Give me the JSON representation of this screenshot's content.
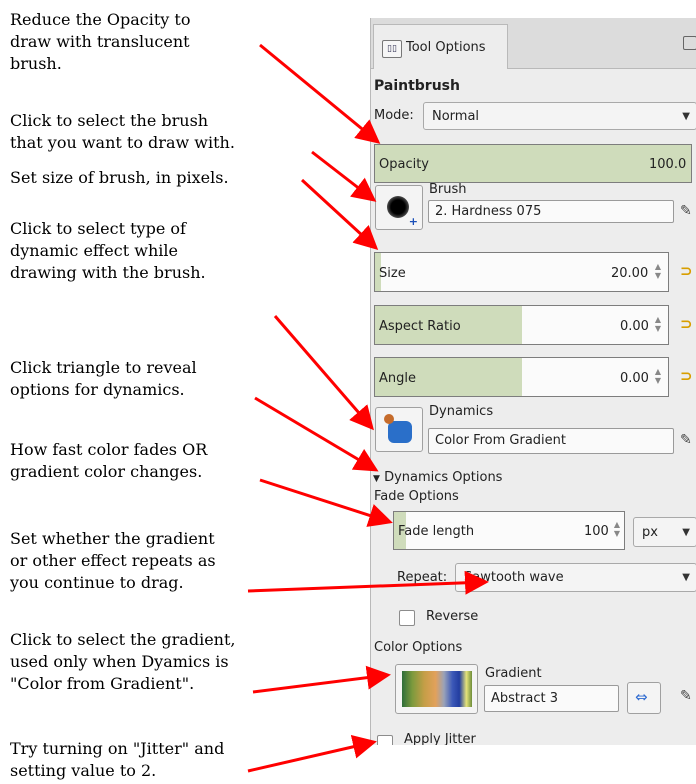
{
  "annotations": [
    "Reduce the Opacity to\ndraw with translucent\nbrush.",
    "Click to select the brush\nthat you want to draw with.",
    "Set size of brush, in pixels.",
    "Click to select type of\ndynamic effect while\ndrawing with the brush.",
    "Click triangle to reveal\noptions for dynamics.",
    "How fast color fades OR\ngradient color changes.",
    "Set whether the gradient\nor other effect repeats as\nyou continue to drag.",
    "Click to select the gradient,\nused only when Dyamics is\n\"Color from Gradient\".",
    "Try turning on \"Jitter\" and\nsetting value to 2."
  ],
  "panel": {
    "tab_label": "Tool Options",
    "tab_icon": "tool-options-icon",
    "tool_title": "Paintbrush",
    "mode_label": "Mode:",
    "mode_value": "Normal",
    "opacity": {
      "label": "Opacity",
      "value": "100.0",
      "level": 1.0
    },
    "brush_label": "Brush",
    "brush_name": "2. Hardness 075",
    "size": {
      "label": "Size",
      "value": "20.00",
      "level": 0.02
    },
    "aspect_ratio": {
      "label": "Aspect Ratio",
      "value": "0.00",
      "level": 0.5
    },
    "angle": {
      "label": "Angle",
      "value": "0.00",
      "level": 0.5
    },
    "dynamics_label": "Dynamics",
    "dynamics_name": "Color From Gradient",
    "dynamics_options_label": "Dynamics Options",
    "fade_options_label": "Fade Options",
    "fade_length": {
      "label": "Fade length",
      "value": "100",
      "unit": "px",
      "level": 0.05
    },
    "repeat_label": "Repeat:",
    "repeat_value": "Sawtooth wave",
    "reverse_label": "Reverse",
    "color_options_label": "Color Options",
    "gradient_label": "Gradient",
    "gradient_name": "Abstract 3",
    "apply_jitter_label": "Apply Jitter"
  },
  "colors": {
    "arrow": "#ff0000",
    "slider_fill": "#cfdcbb",
    "link_icon": "#d89e00"
  }
}
